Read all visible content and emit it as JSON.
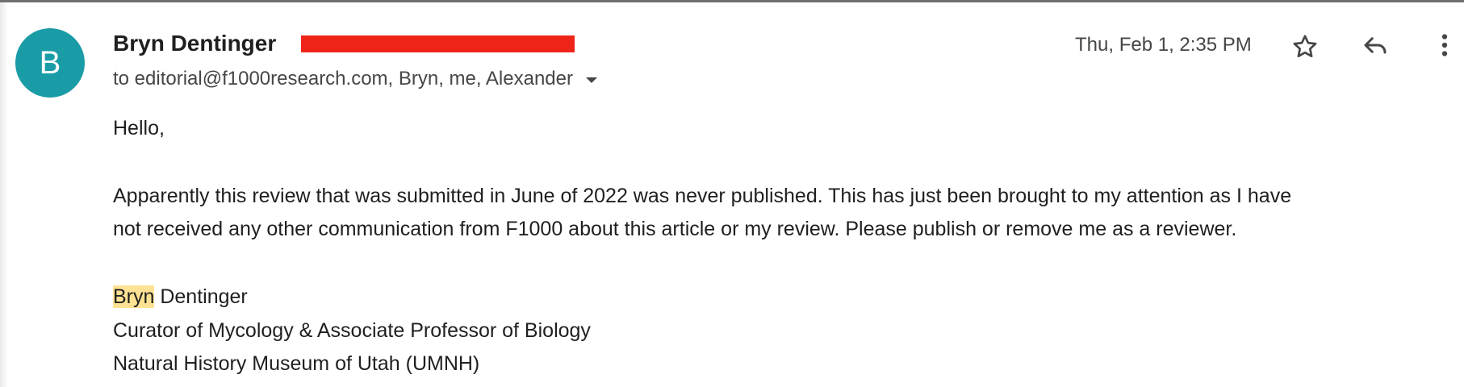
{
  "email": {
    "avatar_letter": "B",
    "avatar_color": "#1a9ca6",
    "sender_name": "Bryn Dentinger",
    "recipients": "to editorial@f1000research.com, Bryn, me, Alexander",
    "timestamp": "Thu, Feb 1, 2:35 PM",
    "redaction_color": "#ee2418",
    "icons": [
      "star-icon",
      "reply-icon",
      "more-vert-icon",
      "chevron-down-icon"
    ]
  },
  "body": {
    "greeting": "Hello,",
    "paragraph_line1": "Apparently this review that was submitted in June of 2022 was never published. This has just been brought to my attention as I have",
    "paragraph_line2": "not received any other communication from F1000 about this article or my review. Please publish or remove me as a reviewer.",
    "signature_first_name": "Bryn",
    "signature_last_name": " Dentinger",
    "signature_title": "Curator of Mycology & Associate Professor of Biology",
    "signature_org": "Natural History Museum of Utah (UMNH)",
    "highlight_color": "#fde293"
  }
}
